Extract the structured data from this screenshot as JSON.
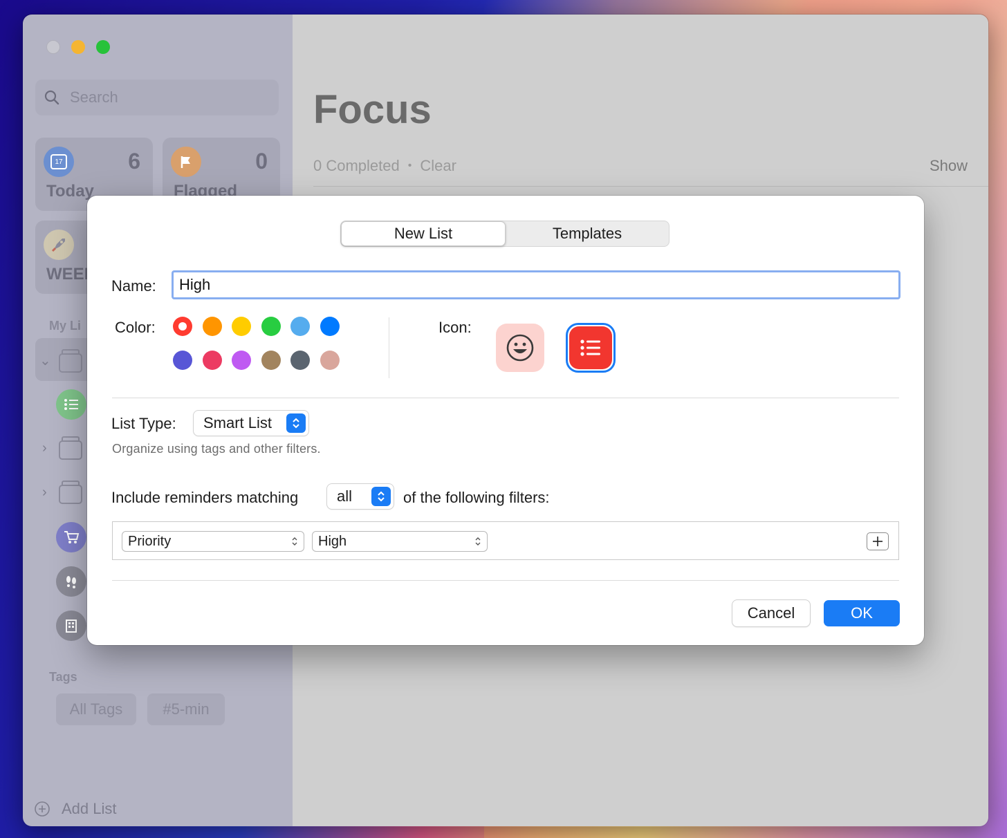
{
  "sidebar": {
    "search_placeholder": "Search",
    "tiles": [
      {
        "label": "Today",
        "count": "6",
        "icon_text": "17"
      },
      {
        "label": "Flagged",
        "count": "0"
      }
    ],
    "week_label": "WEEK",
    "my_lists_heading": "My Li",
    "tags_heading": "Tags",
    "tags": [
      "All Tags",
      "#5-min"
    ],
    "add_list": "Add List"
  },
  "main": {
    "title": "Focus",
    "completed": "0 Completed",
    "clear": "Clear",
    "show": "Show"
  },
  "dialog": {
    "tabs": [
      "New List",
      "Templates"
    ],
    "active_tab": "New List",
    "name_label": "Name:",
    "name_value": "High",
    "color_label": "Color:",
    "colors": [
      "#ff3b30",
      "#ff9500",
      "#ffcc00",
      "#28cd41",
      "#55acee",
      "#007aff",
      "#5856d6",
      "#ec3b62",
      "#bf5af2",
      "#a2845e",
      "#5b6570",
      "#d9a69c"
    ],
    "selected_color": "#ff3b30",
    "icon_label": "Icon:",
    "icons": [
      "smiley-icon",
      "list-bullet-icon"
    ],
    "selected_icon": "list-bullet-icon",
    "list_type_label": "List Type:",
    "list_type_value": "Smart List",
    "list_type_description": "Organize using tags and other filters.",
    "include_prefix": "Include reminders matching",
    "match_value": "all",
    "include_suffix": "of the following filters:",
    "filter": {
      "field": "Priority",
      "value": "High"
    },
    "cancel_label": "Cancel",
    "ok_label": "OK"
  }
}
